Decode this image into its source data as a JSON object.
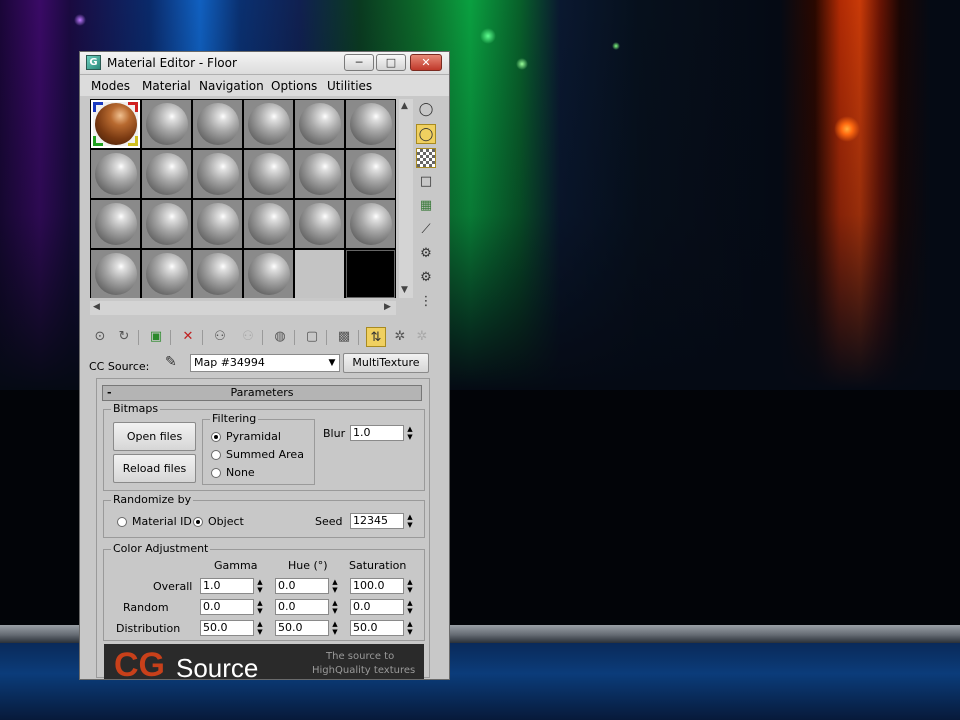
{
  "window": {
    "title": "Material Editor - Floor",
    "minimize_label": "─",
    "maximize_label": "□",
    "close_label": "✕"
  },
  "menu": {
    "items": [
      "Modes",
      "Material",
      "Navigation",
      "Options",
      "Utilities"
    ]
  },
  "sample_slots": {
    "rows": 4,
    "cols": 6,
    "active_slot": "Floor"
  },
  "source": {
    "label": "CC Source:",
    "map_value": "Map #34994",
    "multitexture_label": "MultiTexture"
  },
  "parameters": {
    "header": "Parameters",
    "collapse_symbol": "-",
    "bitmaps": {
      "title": "Bitmaps",
      "open_files": "Open files",
      "reload_files": "Reload files"
    },
    "filtering": {
      "title": "Filtering",
      "options": [
        "Pyramidal",
        "Summed Area",
        "None"
      ],
      "selected": "Pyramidal"
    },
    "blur": {
      "label": "Blur",
      "value": "1.0"
    },
    "randomize": {
      "title": "Randomize by",
      "options": [
        "Material ID",
        "Object"
      ],
      "selected": "Object",
      "seed_label": "Seed",
      "seed_value": "12345"
    },
    "color_adjustment": {
      "title": "Color Adjustment",
      "columns": [
        "Gamma",
        "Hue (°)",
        "Saturation"
      ],
      "rows": [
        {
          "label": "Overall",
          "values": [
            "1.0",
            "0.0",
            "100.0"
          ]
        },
        {
          "label": "Random",
          "values": [
            "0.0",
            "0.0",
            "0.0"
          ]
        },
        {
          "label": "Distribution",
          "values": [
            "50.0",
            "50.0",
            "50.0"
          ]
        }
      ]
    }
  },
  "banner": {
    "logo_cg": "CG",
    "logo_source": "Source",
    "tagline_1": "The source to",
    "tagline_2": "HighQuality textures"
  },
  "colors": {
    "active_tool": "#f0d060",
    "close_button": "#c0392b",
    "banner_logo": "#c8401a"
  }
}
